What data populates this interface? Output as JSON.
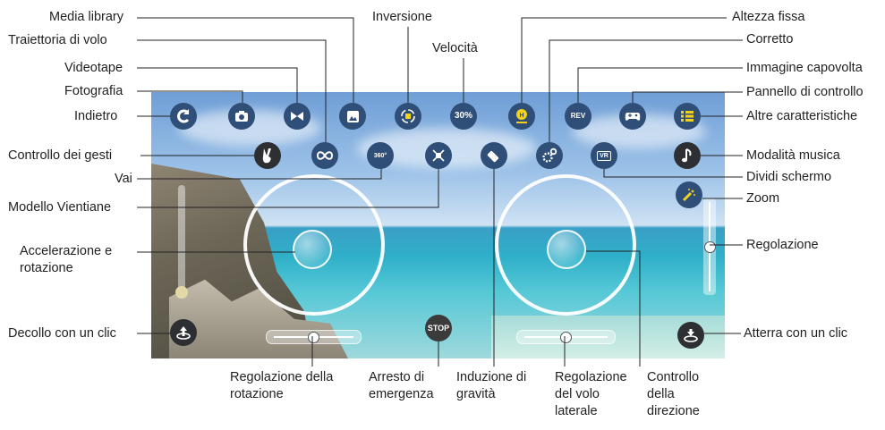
{
  "buttons": {
    "back": "C",
    "speed": "30%",
    "stop": "STOP",
    "rev": "REV",
    "vr": "VR",
    "rotate360": "360°"
  },
  "labels": {
    "media_library": "Media library",
    "inversione": "Inversione",
    "altezza_fissa": "Altezza fissa",
    "traiettoria": "Traiettoria di volo",
    "velocita": "Velocità",
    "corretto": "Corretto",
    "videotape": "Videotape",
    "immagine_capovolta": "Immagine capovolta",
    "fotografia": "Fotografia",
    "pannello": "Pannello di controllo",
    "indietro": "Indietro",
    "altre": "Altre caratteristiche",
    "gesti": "Controllo dei gesti",
    "musica": "Modalità musica",
    "vai": "Vai",
    "dividi": "Dividi schermo",
    "vientiane": "Modello Vientiane",
    "zoom": "Zoom",
    "accelerazione": "Accelerazione e rotazione",
    "regolazione": "Regolazione",
    "decollo": "Decollo con un clic",
    "atterra": "Atterra con un clic",
    "regolazione_rotazione": "Regolazione della rotazione",
    "arresto": "Arresto di emergenza",
    "induzione": "Induzione di gravità",
    "regolazione_laterale": "Regolazione del volo laterale",
    "controllo_direzione": "Controllo della direzione"
  },
  "levels": {
    "left_throttle_fraction": 0.0,
    "rotation_trim_fraction": 0.5,
    "lateral_trim_fraction": 0.5,
    "zoom_adjust_fraction": 0.5
  },
  "colors": {
    "button_blue": "#2f4f78",
    "button_dark": "#2d2f33",
    "icon_yellow": "#f2d21b"
  },
  "icons": [
    "back-arrow-icon",
    "camera-icon",
    "video-icon",
    "gallery-icon",
    "flip-icon",
    "speed-icon",
    "altitude-hold-icon",
    "rev-icon",
    "gamepad-icon",
    "menu-list-icon",
    "gesture-icon",
    "flight-path-icon",
    "rotate-360-icon",
    "vientiane-icon",
    "gravity-icon",
    "gear-icon",
    "vr-icon",
    "music-icon",
    "zoom-icon",
    "takeoff-icon",
    "landing-icon",
    "stop-icon"
  ]
}
